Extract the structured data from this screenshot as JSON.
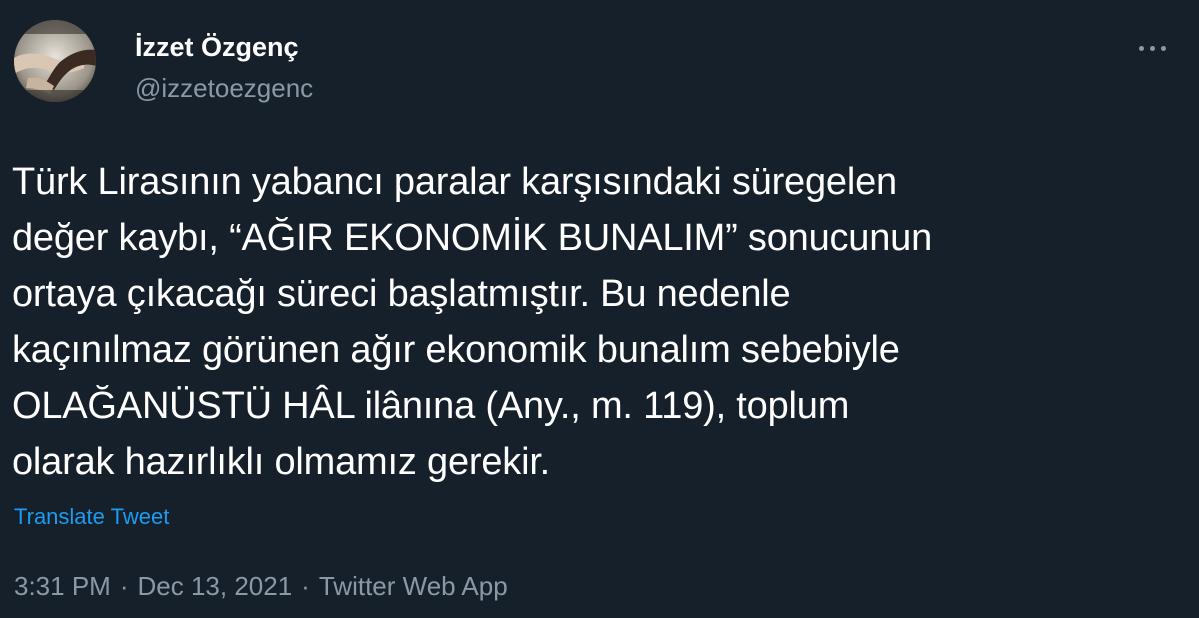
{
  "tweet": {
    "author": {
      "display_name": "İzzet Özgenç",
      "handle": "@izzetoezgenc",
      "avatar_icon": "profile-photo-hands"
    },
    "more_icon": "more-options-icon",
    "text_lines": [
      "Türk Lirasının yabancı paralar karşısındaki süregelen",
      "değer kaybı, “AĞIR EKONOMİK BUNALIM” sonucunun",
      "ortaya çıkacağı süreci başlatmıştır. Bu nedenle",
      "kaçınılmaz görünen ağır ekonomik bunalım sebebiyle",
      "OLAĞANÜSTÜ HÂL ilânına (Any., m. 119), toplum",
      "olarak hazırlıklı olmamız gerekir."
    ],
    "translate_label": "Translate Tweet",
    "time": "3:31 PM",
    "separator": "·",
    "date": "Dec 13, 2021",
    "source": "Twitter Web App"
  },
  "colors": {
    "background": "#15202b",
    "text_primary": "#ffffff",
    "text_secondary": "#8b98a5",
    "accent": "#1d9bf0"
  }
}
